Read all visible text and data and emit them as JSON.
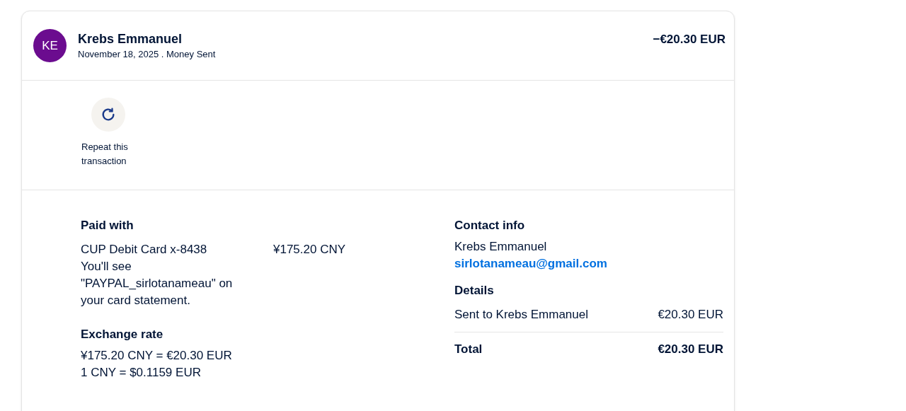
{
  "header": {
    "initials": "KE",
    "name": "Krebs Emmanuel",
    "subtitle": "November 18, 2025 . Money Sent",
    "amount": "−€20.30 EUR"
  },
  "actions": [
    {
      "label": "Repeat this transaction"
    }
  ],
  "paid_with": {
    "heading": "Paid with",
    "card": "CUP Debit Card x-8438",
    "amount": "¥175.20 CNY",
    "note": "You'll see \"PAYPAL_sirlotanameau\" on your card statement."
  },
  "exchange_rate": {
    "heading": "Exchange rate",
    "lines": [
      "¥175.20 CNY = €20.30 EUR",
      "1 CNY = $0.1159 EUR"
    ]
  },
  "contact": {
    "heading": "Contact info",
    "name": "Krebs Emmanuel",
    "email": "sirlotanameau@gmail.com"
  },
  "details": {
    "heading": "Details",
    "rows": [
      {
        "label": "Sent to Krebs Emmanuel",
        "value": "€20.30 EUR"
      }
    ],
    "total": {
      "label": "Total",
      "value": "€20.30 EUR"
    }
  }
}
